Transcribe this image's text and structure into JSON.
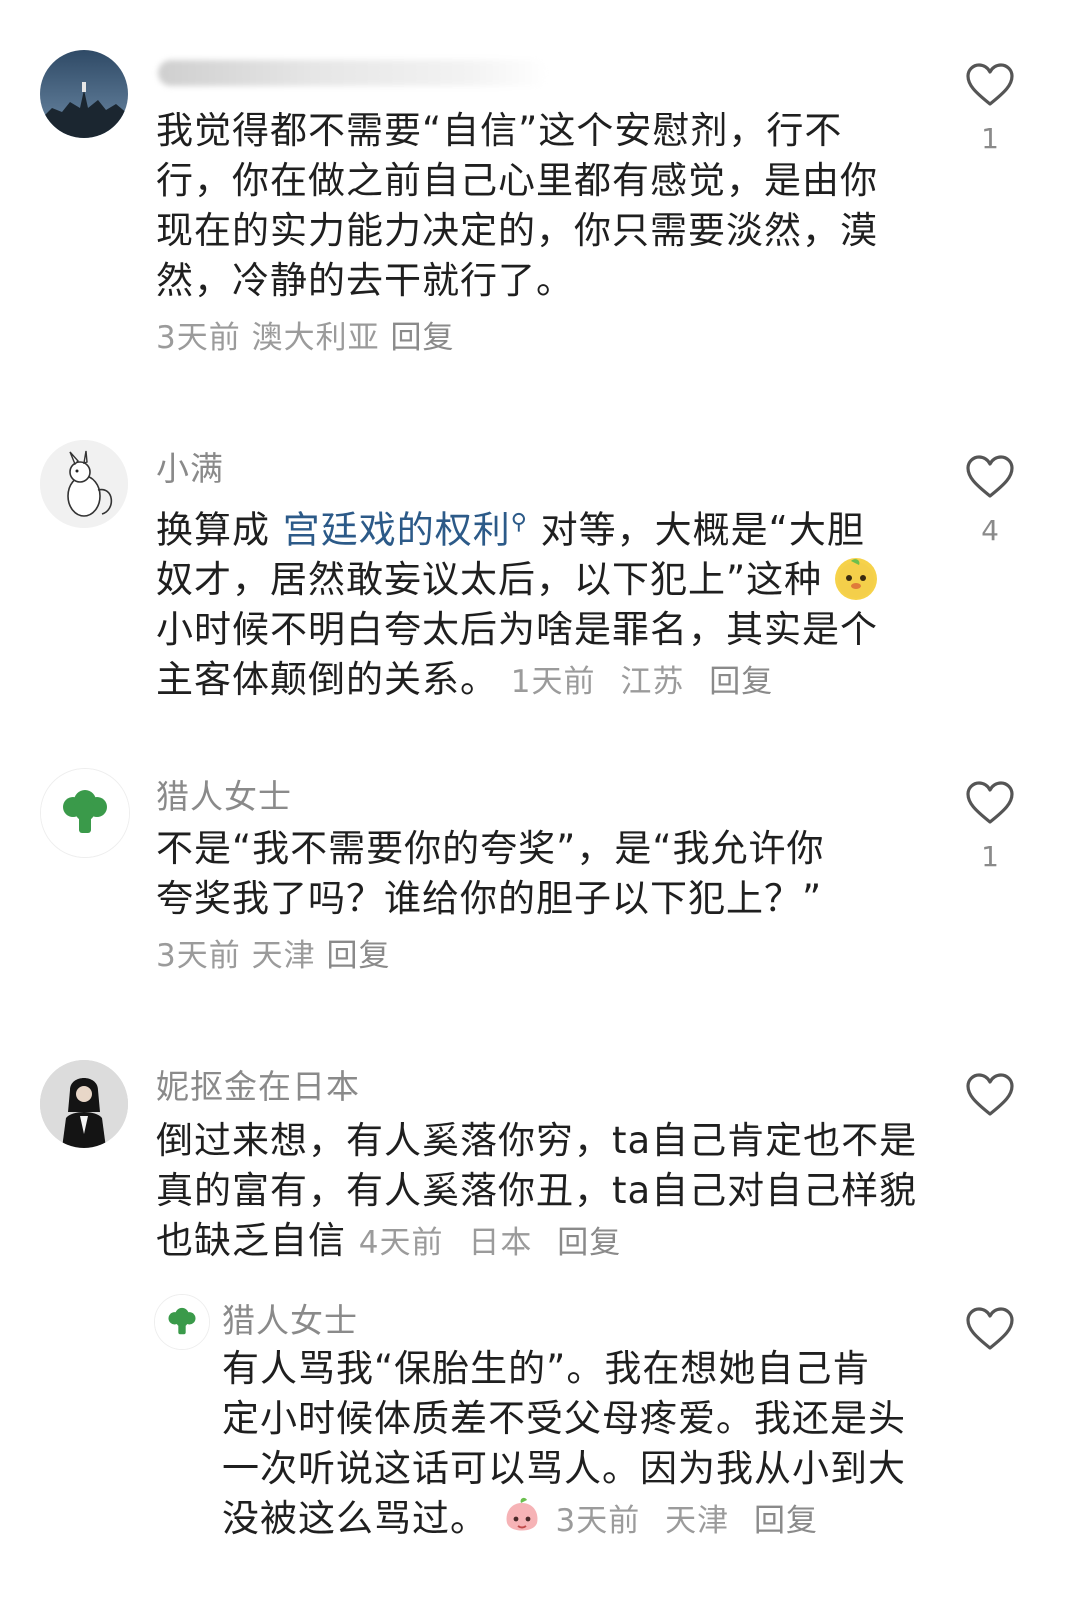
{
  "comments": [
    {
      "username": "",
      "text": "我觉得都不需要“自信”这个安慰剂，行不行，你在做之前自己心里都有感觉，是由你现在的实力能力决定的，你只需要淡然，漠然，冷静的去干就行了。",
      "lines": [
        "我觉得都不需要“自信”这个安慰剂，行不",
        "行，你在做之前自己心里都有感觉，是由你",
        "现在的实力能力决定的，你只需要淡然，漠",
        "然，冷静的去干就行了。"
      ],
      "time": "3天前",
      "location": "澳大利亚",
      "reply": "回复",
      "likes": "1"
    },
    {
      "username": "小满",
      "lines": [
        "换算成 ",
        "宫廷戏的权利",
        " 对等，大概是“大胆",
        "奴才，居然敢妄议太后，以下犯上”这种",
        "小时候不明白夸太后为啥是罪名，其实是个",
        "主客体颠倒的关系。"
      ],
      "link_text": "宫廷戏的权利",
      "search_glyph": "⚲",
      "time": "1天前",
      "location": "江苏",
      "reply": "回复",
      "likes": "4"
    },
    {
      "username": "猎人女士",
      "lines": [
        "不是“我不需要你的夸奖”，是“我允许你",
        "夸奖我了吗？谁给你的胆子以下犯上？”"
      ],
      "time": "3天前",
      "location": "天津",
      "reply": "回复",
      "likes": "1"
    },
    {
      "username": "妮抠金在日本",
      "lines": [
        "倒过来想，有人奚落你穷，ta自己肯定也不是",
        "真的富有，有人奚落你丑，ta自己对自己样貌",
        "也缺乏自信"
      ],
      "time": "4天前",
      "location": "日本",
      "reply": "回复",
      "likes": ""
    }
  ],
  "reply_comment": {
    "username": "猎人女士",
    "lines": [
      "有人骂我“保胎生的”。我在想她自己肯",
      "定小时候体质差不受父母疼爱。我还是头",
      "一次听说这话可以骂人。因为我从小到大",
      "没被这么骂过。"
    ],
    "time": "3天前",
    "location": "天津",
    "reply": "回复",
    "likes": ""
  },
  "colors": {
    "text": "#1f1f1f",
    "meta": "#9b9b9b",
    "link": "#2c5a88",
    "broccoli": "#3a9a4a"
  },
  "icons": [
    "heart-outline-icon",
    "search-icon",
    "emoji-face-icon",
    "emoji-peach-icon",
    "broccoli-avatar-icon"
  ]
}
